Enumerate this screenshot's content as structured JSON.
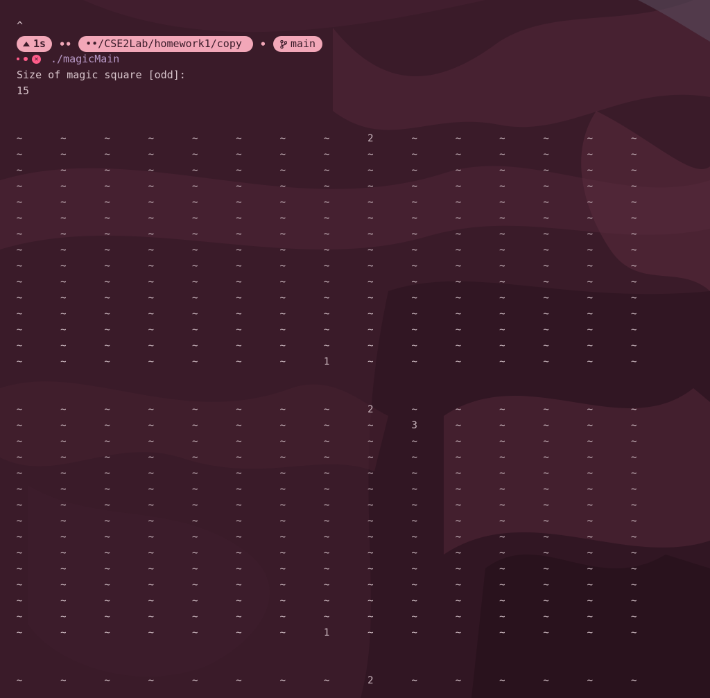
{
  "prompt": {
    "caret": "^",
    "duration": "1s",
    "path_prefix": "••",
    "path": "••/CSE2Lab/homework1/copy",
    "separator": "•",
    "branch": "main",
    "command": "./magicMain"
  },
  "colors": {
    "background": "#3a1b29",
    "pill": "#f2a7b8",
    "pill_text": "#3a1b29",
    "error": "#ff5c8a",
    "command": "#b99ac8",
    "text": "#d9c6cd"
  },
  "icons": {
    "duration": "arrow-up-icon",
    "branch": "git-branch-icon",
    "status": "close-circle-icon"
  },
  "output": {
    "question": "Size of magic square [odd]:",
    "answer": "15"
  },
  "blocks": [
    {
      "filler": "~",
      "rows": 15,
      "cols": 15,
      "numbers": [
        {
          "row": 0,
          "col": 8,
          "value": "2"
        },
        {
          "row": 14,
          "col": 7,
          "value": "1"
        }
      ]
    },
    {
      "filler": "~",
      "rows": 15,
      "cols": 15,
      "numbers": [
        {
          "row": 0,
          "col": 8,
          "value": "2"
        },
        {
          "row": 1,
          "col": 9,
          "value": "3"
        },
        {
          "row": 14,
          "col": 7,
          "value": "1"
        }
      ]
    },
    {
      "filler": "~",
      "rows": 1,
      "cols": 15,
      "numbers": [
        {
          "row": 0,
          "col": 8,
          "value": "2"
        }
      ]
    }
  ]
}
